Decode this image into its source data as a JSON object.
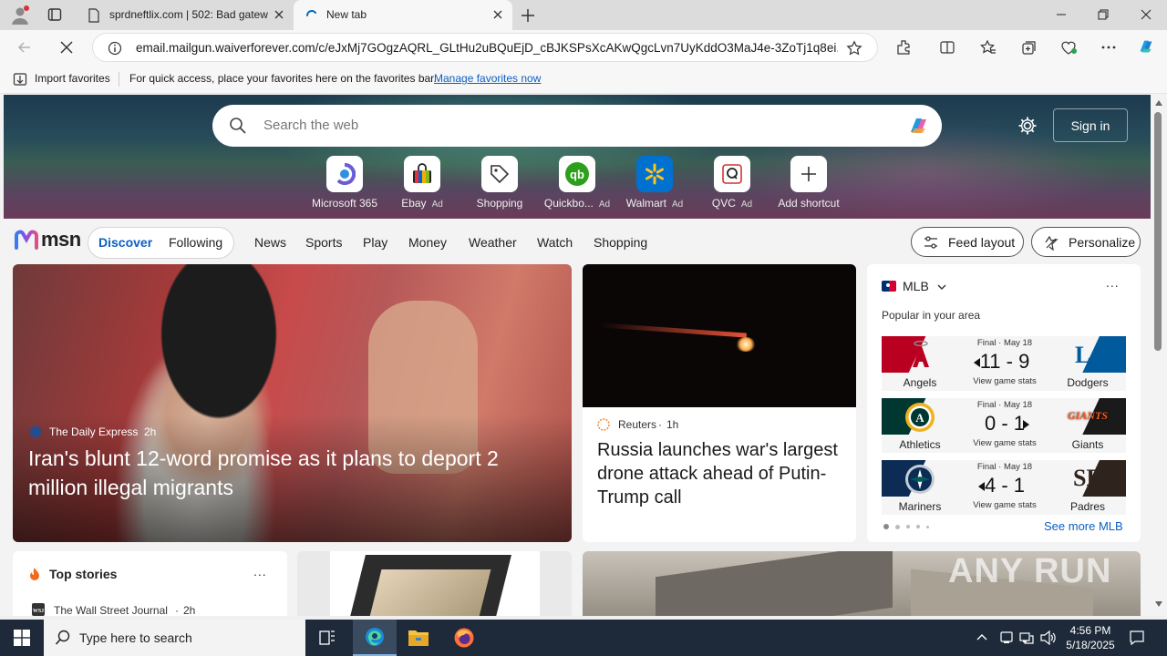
{
  "browser": {
    "tabs": [
      {
        "title": "sprdneftlix.com | 502: Bad gatew"
      },
      {
        "title": "New tab"
      }
    ],
    "address": "email.mailgun.waiverforever.com/c/eJxMj7GOgzAQRL_GLtHu2uBQuEjD_cBJKSPsXcAKwQgcLvn7UyKddO3MaJ4e-3ZoTj1q8ei...",
    "favorites_bar": {
      "import_label": "Import favorites",
      "hint": "For quick access, place your favorites here on the favorites bar.",
      "manage_link": "Manage favorites now"
    }
  },
  "newtab": {
    "search_placeholder": "Search the web",
    "signin_label": "Sign in",
    "shortcuts": [
      {
        "label": "Microsoft 365",
        "ad": ""
      },
      {
        "label": "Ebay",
        "ad": "Ad"
      },
      {
        "label": "Shopping",
        "ad": ""
      },
      {
        "label": "Quickbo...",
        "ad": "Ad"
      },
      {
        "label": "Walmart",
        "ad": "Ad"
      },
      {
        "label": "QVC",
        "ad": "Ad"
      },
      {
        "label": "Add shortcut",
        "ad": ""
      }
    ],
    "msn": {
      "logo_text": "msn",
      "pill_tabs": [
        "Discover",
        "Following"
      ],
      "nav_items": [
        "News",
        "Sports",
        "Play",
        "Money",
        "Weather",
        "Watch",
        "Shopping"
      ],
      "feed_layout_label": "Feed layout",
      "personalize_label": "Personalize"
    },
    "main_story": {
      "source": "The Daily Express",
      "age": "2h",
      "title": "Iran's blunt 12-word promise as it plans to deport 2 million illegal migrants"
    },
    "second_story": {
      "source": "Reuters",
      "age": "1h",
      "title": "Russia launches war's largest drone attack ahead of Putin-Trump call"
    },
    "mlb": {
      "title": "MLB",
      "subtitle": "Popular in your area",
      "more": "...",
      "see_more": "See more MLB",
      "games": [
        {
          "meta": "Final · May 18",
          "away": "Angels",
          "home": "Dodgers",
          "score": "11 - 9",
          "arrow": "left",
          "link": "View game stats",
          "away_color": "#ba0021",
          "home_color": "#005a9c"
        },
        {
          "meta": "Final · May 18",
          "away": "Athletics",
          "home": "Giants",
          "score": "0 - 1",
          "arrow": "right",
          "link": "View game stats",
          "away_color": "#003831",
          "home_color": "#1a1a1a"
        },
        {
          "meta": "Final · May 18",
          "away": "Mariners",
          "home": "Padres",
          "score": "4 - 1",
          "arrow": "left",
          "link": "View game stats",
          "away_color": "#0c2c56",
          "home_color": "#2f241d"
        }
      ]
    },
    "top_stories": {
      "title": "Top stories",
      "more": "...",
      "first_source": "The Wall Street Journal",
      "first_age": "2h"
    }
  },
  "taskbar": {
    "search_placeholder": "Type here to search",
    "time": "4:56 PM",
    "date": "5/18/2025"
  },
  "watermark": "ANY RUN"
}
